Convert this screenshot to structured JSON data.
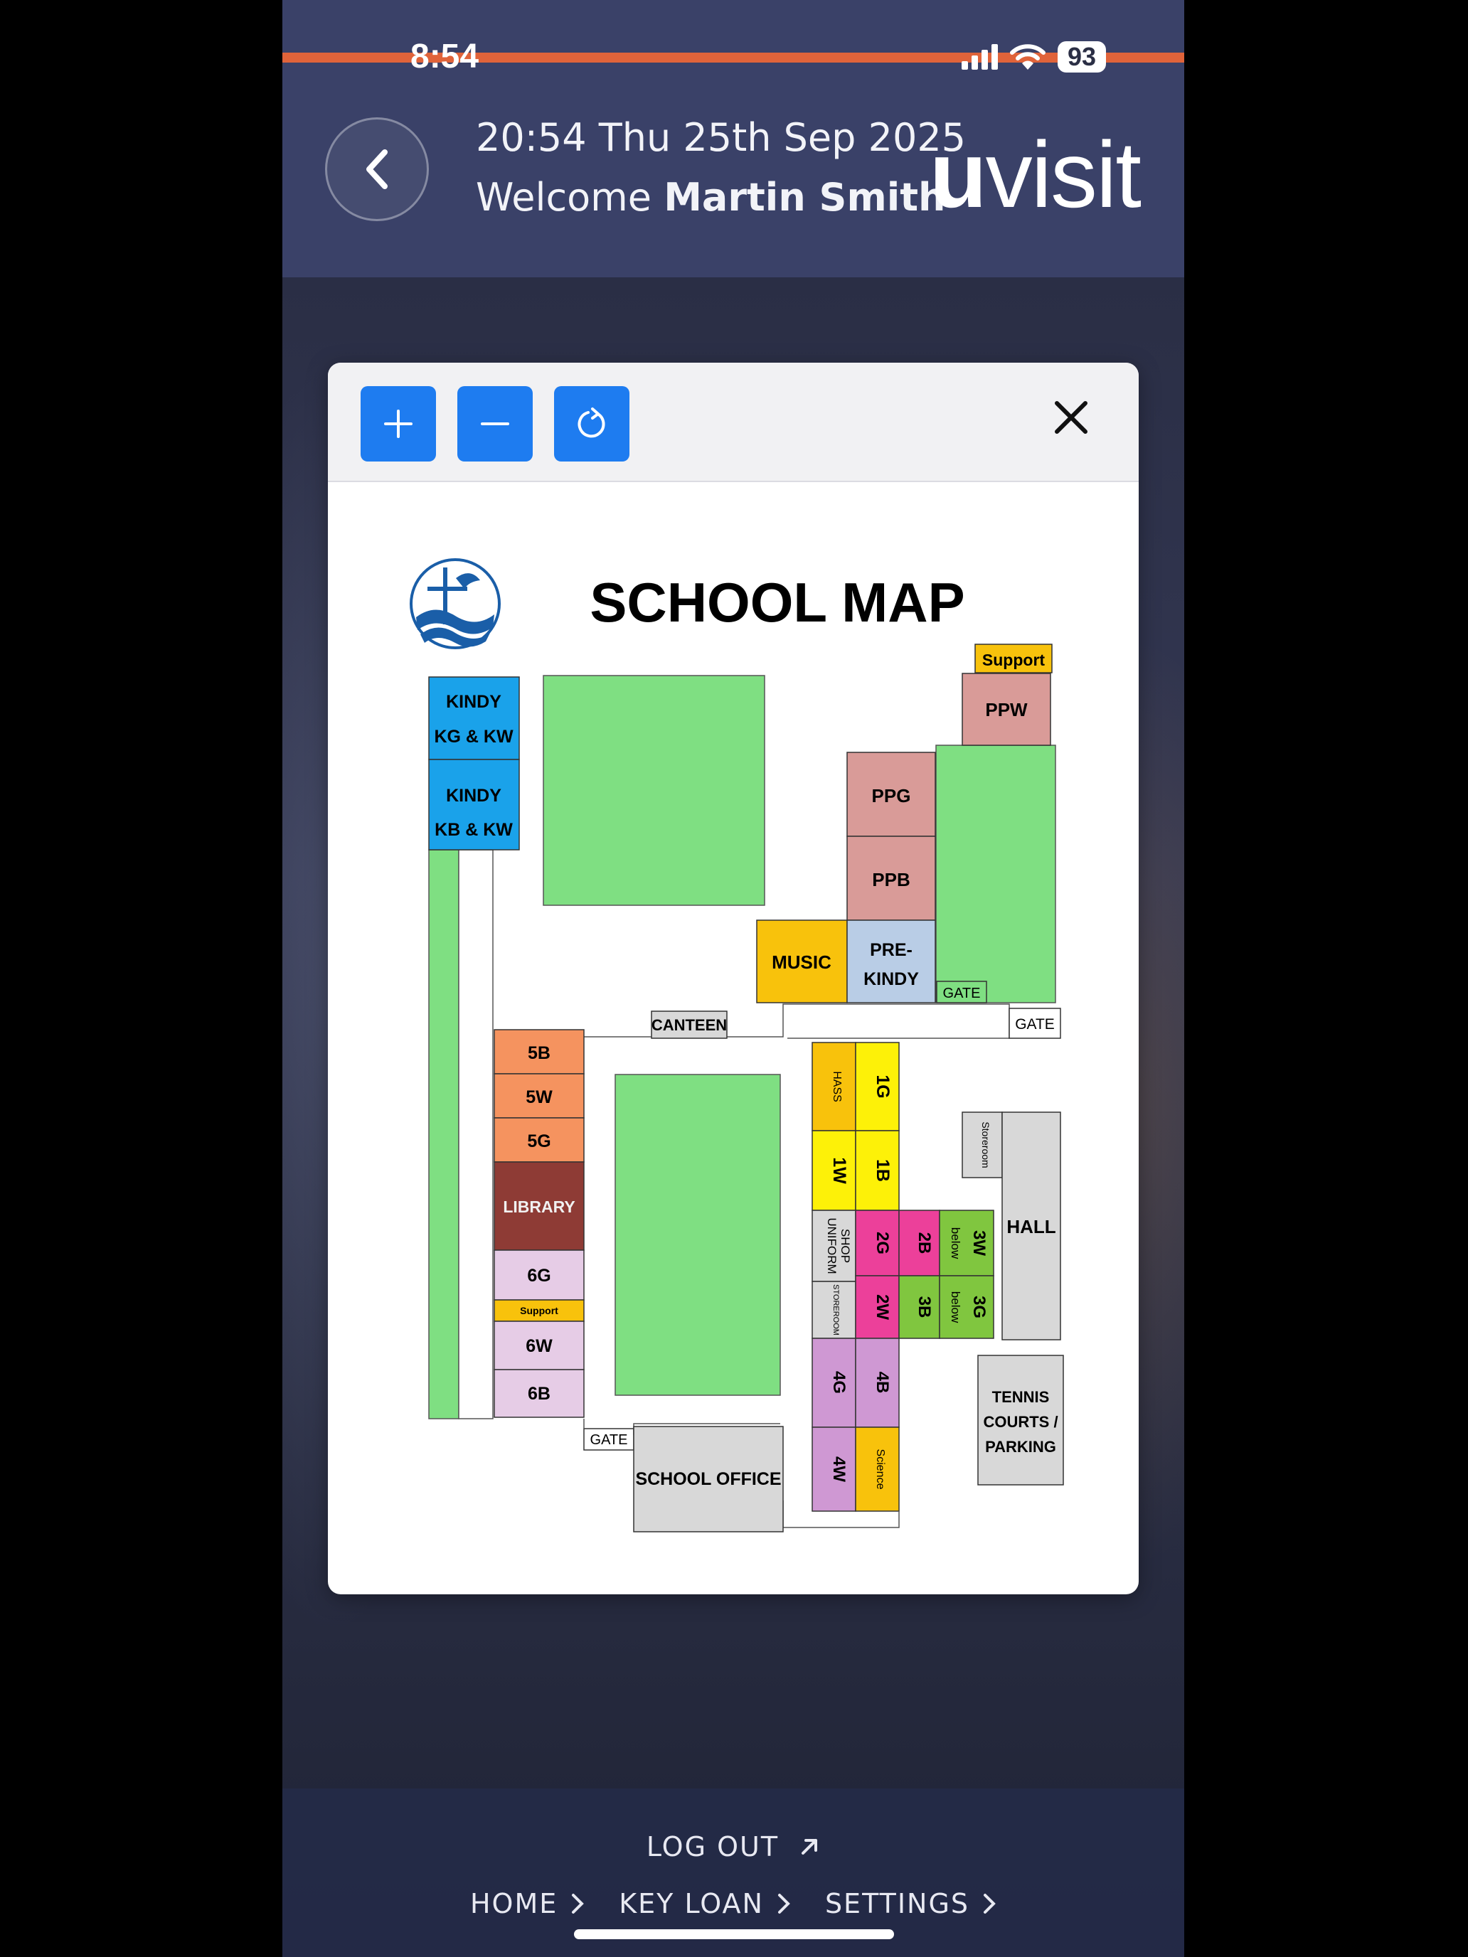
{
  "status_bar": {
    "time": "8:54",
    "battery": "93"
  },
  "header": {
    "datetime": "20:54 Thu 25th Sep 2025",
    "welcome_prefix": "Welcome",
    "user_name": "Martin Smith",
    "logo_u": "u",
    "logo_rest": "visit"
  },
  "modal": {
    "zoom_in_icon": "plus-icon",
    "zoom_out_icon": "minus-icon",
    "reset_icon": "rotate-icon",
    "close_icon": "close-icon"
  },
  "map": {
    "title": "SCHOOL MAP",
    "labels": {
      "support_top": "Support",
      "ppw": "PPW",
      "kindy1_a": "KINDY",
      "kindy1_b": "KG & KW",
      "kindy2_a": "KINDY",
      "kindy2_b": "KB & KW",
      "ppg": "PPG",
      "ppb": "PPB",
      "music": "MUSIC",
      "prekindy_a": "PRE-",
      "prekindy_b": "KINDY",
      "gate_inner": "GATE",
      "gate_right": "GATE",
      "canteen": "CANTEEN",
      "r5b": "5B",
      "r5w": "5W",
      "r5g": "5G",
      "library": "LIBRARY",
      "r6g": "6G",
      "support_small": "Support",
      "r6w": "6W",
      "r6b": "6B",
      "hass": "HASS",
      "r1g": "1G",
      "r1w": "1W",
      "r1b": "1B",
      "uniform_a": "UNIFORM",
      "uniform_b": "SHOP",
      "r2g": "2G",
      "r2b": "2B",
      "below1": "below",
      "r3w": "3W",
      "storeroom_small": "STOREROOM",
      "r2w": "2W",
      "r3b": "3B",
      "below2": "below",
      "r3g": "3G",
      "r4g": "4G",
      "r4b": "4B",
      "r4w": "4W",
      "science": "Science",
      "storeroom": "Storeroom",
      "hall": "HALL",
      "tennis_a": "TENNIS",
      "tennis_b": "COURTS /",
      "tennis_c": "PARKING",
      "gate_bottom": "GATE",
      "school_office": "SCHOOL OFFICE"
    },
    "colors": {
      "green": "#7fdf82",
      "blue": "#1aa2ea",
      "pink": "#d99b98",
      "lightblue": "#b9cde6",
      "gold": "#f8c20c",
      "orange": "#f5935f",
      "library": "#8e3b35",
      "lavender": "#e6cce6",
      "yellow": "#fdf108",
      "magenta": "#ec409a",
      "lime": "#80c63f",
      "violet": "#cf98d3",
      "grey": "#d8d8d8"
    }
  },
  "footer": {
    "logout": "LOG OUT",
    "nav": [
      "HOME",
      "KEY LOAN",
      "SETTINGS"
    ]
  }
}
